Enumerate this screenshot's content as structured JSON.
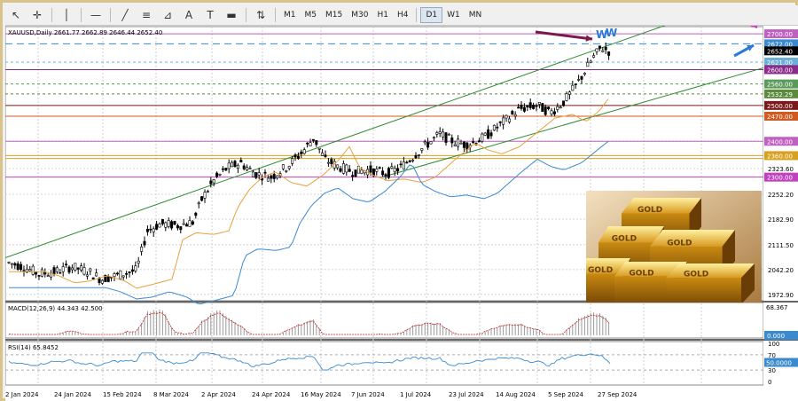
{
  "toolbar": {
    "tools": [
      {
        "name": "cursor-icon",
        "glyph": "↖"
      },
      {
        "name": "crosshair-icon",
        "glyph": "✛"
      },
      {
        "name": "vertical-line-icon",
        "glyph": "│"
      },
      {
        "name": "horizontal-line-icon",
        "glyph": "—"
      },
      {
        "name": "trendline-icon",
        "glyph": "╱"
      },
      {
        "name": "fibonacci-icon",
        "glyph": "≡"
      },
      {
        "name": "shapes-icon",
        "glyph": "⊿"
      },
      {
        "name": "text-icon",
        "glyph": "A"
      },
      {
        "name": "text-label-icon",
        "glyph": "T"
      },
      {
        "name": "rectangle-icon",
        "glyph": "▬"
      },
      {
        "name": "arrows-icon",
        "glyph": "⇅"
      }
    ],
    "timeframes": [
      "M1",
      "M5",
      "M15",
      "M30",
      "H1",
      "H4",
      "D1",
      "W1",
      "MN"
    ],
    "active_timeframe": "D1"
  },
  "chart": {
    "symbol_line": "XAUUSD,Daily  2661.77 2662.89 2646.44 2652.40",
    "grid_color": "#c0c0c0",
    "up_color": "#000000",
    "ma_fast_color": "#e8a040",
    "ma_slow_color": "#3a8ad0",
    "channel_color": "#2e8b2e",
    "price_labels": [
      {
        "text": "2700.00",
        "color": "#c060c0"
      },
      {
        "text": "2672.00",
        "color": "#3a8ad0"
      },
      {
        "text": "2652.40",
        "color": "#000000"
      },
      {
        "text": "2621.00",
        "color": "#6ab0d8"
      },
      {
        "text": "2600.00",
        "color": "#8a2a8a"
      },
      {
        "text": "2560.00",
        "color": "#5a9a5a"
      },
      {
        "text": "2532.29",
        "color": "#5a8a3a"
      },
      {
        "text": "2500.00",
        "color": "#7a1a1a"
      },
      {
        "text": "2470.00",
        "color": "#d05a20"
      },
      {
        "text": "2400.00",
        "color": "#c060c0"
      },
      {
        "text": "2360.00",
        "color": "#d8a020"
      },
      {
        "text": "2300.00",
        "color": "#c040c0"
      }
    ],
    "scale_labels": [
      "2323.60",
      "2252.20",
      "2182.90",
      "2111.50",
      "2042.20",
      "1972.90"
    ],
    "date_labels": [
      "2 Jan 2024",
      "24 Jan 2024",
      "15 Feb 2024",
      "8 Mar 2024",
      "2 Apr 2024",
      "24 Apr 2024",
      "16 May 2024",
      "7 Jun 2024",
      "1 Jul 2024",
      "23 Jul 2024",
      "14 Aug 2024",
      "5 Sep 2024",
      "27 Sep 2024"
    ]
  },
  "chart_data": {
    "type": "line",
    "title": "XAUUSD,Daily",
    "ylim": [
      1972.9,
      2720
    ],
    "x": [
      "2 Jan 2024",
      "24 Jan 2024",
      "15 Feb 2024",
      "8 Mar 2024",
      "2 Apr 2024",
      "24 Apr 2024",
      "16 May 2024",
      "7 Jun 2024",
      "1 Jul 2024",
      "23 Jul 2024",
      "14 Aug 2024",
      "5 Sep 2024",
      "27 Sep 2024"
    ],
    "series": [
      {
        "values": [
          2060,
          2025,
          2010,
          2160,
          2270,
          2325,
          2400,
          2300,
          2330,
          2400,
          2500,
          2495,
          2660
        ]
      }
    ]
  },
  "macd": {
    "label": "MACD(12,26,9) 44.343 42.500",
    "scale_top": "68.367",
    "scale_zero": "0.000"
  },
  "rsi": {
    "label": "RSI(14) 65.8452",
    "scale": [
      "100",
      "70",
      "50.0000",
      "30",
      "0"
    ]
  },
  "image_text": {
    "bar_label": "GOLD"
  }
}
